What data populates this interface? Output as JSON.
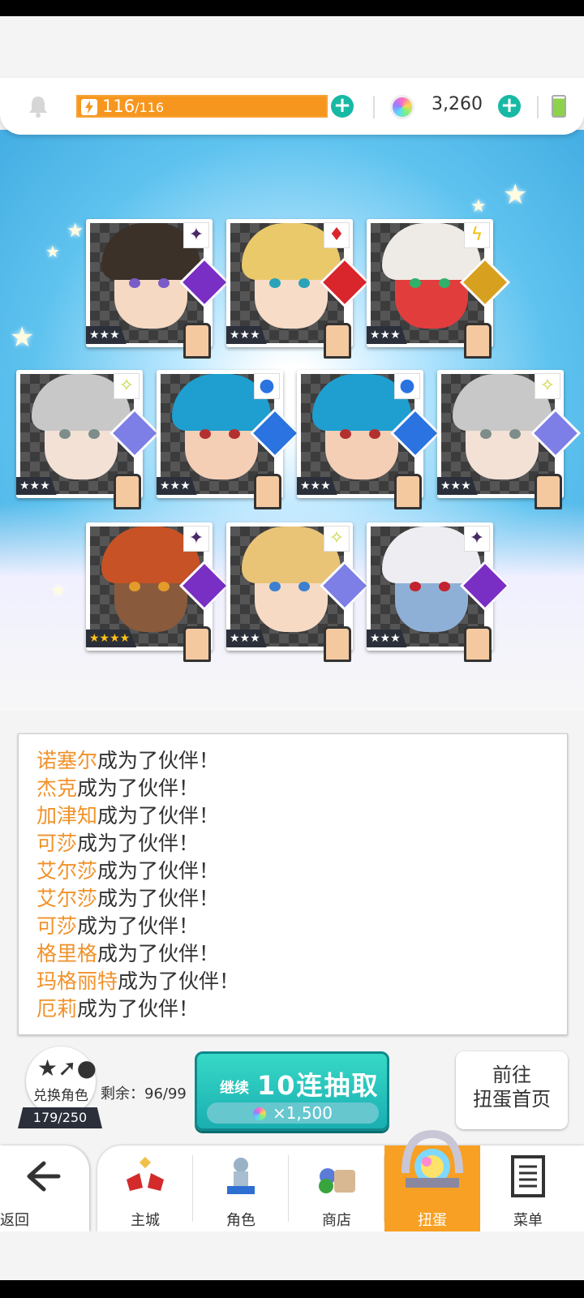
{
  "header": {
    "stamina_current": "116",
    "stamina_max": "/116",
    "gems": "3,260"
  },
  "cards": [
    {
      "stars": "★★★",
      "element": "dark-icon",
      "hair": "#3b3129",
      "skin": "#f6d9c2",
      "eye": "#7a5cc8",
      "gem": "#7a2fc4"
    },
    {
      "stars": "★★★",
      "element": "fire-icon",
      "hair": "#e9c96a",
      "skin": "#f7dcc7",
      "eye": "#2aa3b8",
      "gem": "#d8262c"
    },
    {
      "stars": "★★★",
      "element": "lightning-icon",
      "hair": "#eeeae6",
      "skin": "#e23d3d",
      "eye": "#30b16a",
      "gem": "#d8a01f"
    },
    {
      "stars": "★★★",
      "element": "light-icon",
      "hair": "#c8c8c8",
      "skin": "#f3e1d6",
      "eye": "#7e8d8a",
      "gem": "#7d7fe6"
    },
    {
      "stars": "★★★",
      "element": "water-icon",
      "hair": "#1e9fd0",
      "skin": "#f4cfb6",
      "eye": "#b2312f",
      "gem": "#2a73e0"
    },
    {
      "stars": "★★★",
      "element": "water-icon",
      "hair": "#1e9fd0",
      "skin": "#f4cfb6",
      "eye": "#b2312f",
      "gem": "#2a73e0"
    },
    {
      "stars": "★★★",
      "element": "light-icon",
      "hair": "#c8c8c8",
      "skin": "#f3e1d6",
      "eye": "#7e8d8a",
      "gem": "#7d7fe6"
    },
    {
      "stars": "★★★★",
      "element": "dark-icon",
      "hair": "#c65226",
      "skin": "#8a5a3d",
      "eye": "#e39b2b",
      "gem": "#7a2fc4"
    },
    {
      "stars": "★★★",
      "element": "light-icon",
      "hair": "#e9c477",
      "skin": "#f6dac4",
      "eye": "#3c7fd0",
      "gem": "#7d7fe6"
    },
    {
      "stars": "★★★",
      "element": "dark-icon",
      "hair": "#eeeef2",
      "skin": "#8fb0d6",
      "eye": "#c4232f",
      "gem": "#7a2fc4"
    }
  ],
  "messages": {
    "suffix": "成为了伙伴！",
    "names": [
      "诺塞尔",
      "杰克",
      "加津知",
      "可莎",
      "艾尔莎",
      "艾尔莎",
      "可莎",
      "格里格",
      "玛格丽特",
      "厄莉"
    ]
  },
  "exchange": {
    "label": "兑换角色",
    "count": "179/250",
    "remain": "剩余：96/99"
  },
  "pull_button": {
    "continue": "继续",
    "title": "10连抽取",
    "cost": "×1,500"
  },
  "goto_button": {
    "line1": "前往",
    "line2": "扭蛋首页"
  },
  "nav": {
    "back": "返回",
    "items": [
      "主城",
      "角色",
      "商店",
      "扭蛋",
      "菜单"
    ],
    "active": "扭蛋"
  },
  "colors": {
    "accent_orange": "#f7a023",
    "teal": "#17b9a4",
    "name_orange": "#f0922a"
  }
}
